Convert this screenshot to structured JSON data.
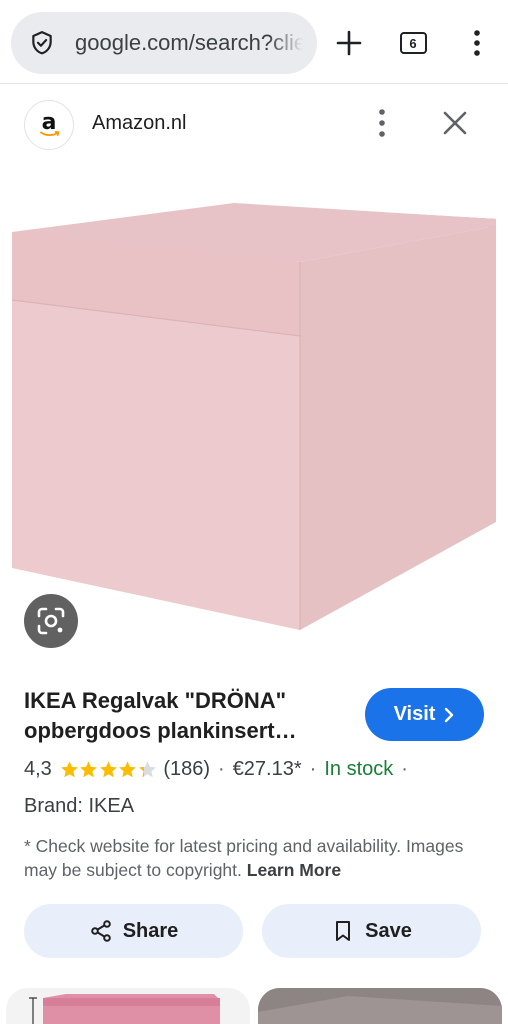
{
  "browser": {
    "url": "google.com/search?client=ms-android",
    "tab_count": "6"
  },
  "source": {
    "name": "Amazon.nl",
    "logo_letter": "a"
  },
  "product": {
    "title_line1": "IKEA Regalvak \"DRÖNA\"",
    "title_line2": "opbergdoos plankinsert…",
    "rating": "4,3",
    "stars": 4.3,
    "reviews": "(186)",
    "price": "€27.13*",
    "stock": "In stock",
    "brand": "Brand: IKEA",
    "disclaimer": "* Check website for latest pricing and availability. Images may be subject to copyright.",
    "learn_more": "Learn More"
  },
  "actions": {
    "visit": "Visit",
    "share": "Share",
    "save": "Save"
  },
  "colors": {
    "accent": "#1a73e8",
    "stock_green": "#188038",
    "star": "#fbbc04",
    "box_pink": "#ecc8cb"
  }
}
